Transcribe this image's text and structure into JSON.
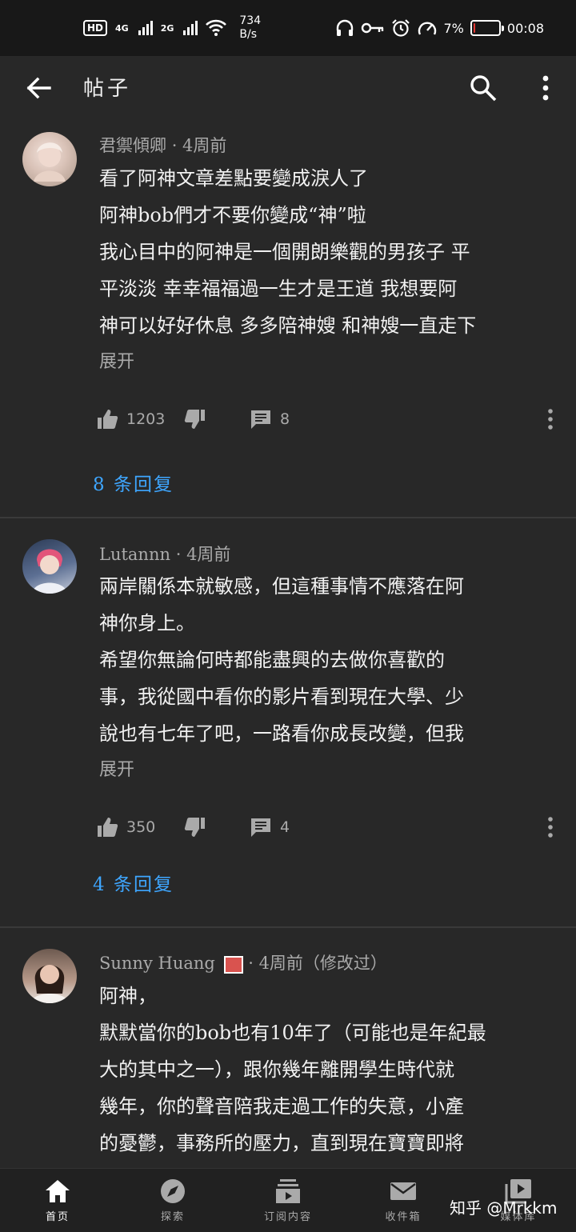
{
  "status_bar": {
    "hd": "HD",
    "sim1": "4G",
    "sim2": "2G",
    "speed_value": "734",
    "speed_unit": "B/s",
    "battery_percent": "7%",
    "battery_level": 0.07,
    "time": "00:08",
    "icons": [
      "hd-icon",
      "signal-icon",
      "wifi-icon",
      "headphone-icon",
      "key-icon",
      "alarm-icon",
      "speedometer-icon",
      "battery-icon"
    ]
  },
  "app_bar": {
    "title": "帖子",
    "icons": [
      "back-arrow-icon",
      "search-icon",
      "more-vert-icon"
    ]
  },
  "comments": [
    {
      "author": "君禦傾卿",
      "time": "4周前",
      "lines": [
        "看了阿神文章差點要變成淚人了",
        "阿神bob們才不要你變成“神”啦",
        "我心目中的阿神是一個開朗樂觀的男孩子 平",
        "平淡淡 幸幸福福過一生才是王道 我想要阿",
        "神可以好好休息 多多陪神嫂 和神嫂一直走下"
      ],
      "expand": "展开",
      "likes": "1203",
      "replies_count": "8",
      "replies_link": "8 条回复"
    },
    {
      "author": "Lutannn",
      "time": "4周前",
      "lines": [
        "兩岸關係本就敏感，但這種事情不應落在阿",
        "神你身上。",
        "希望你無論何時都能盡興的去做你喜歡的",
        "事，我從國中看你的影片看到現在大學、少",
        "說也有七年了吧，一路看你成長改變，但我"
      ],
      "expand": "展开",
      "likes": "350",
      "replies_count": "4",
      "replies_link": "4 条回复"
    },
    {
      "author": "Sunny Huang",
      "time": "4周前（修改过）",
      "lines": [
        "阿神，",
        "默默當你的bob也有10年了（可能也是年紀最",
        "大的其中之一），跟你幾年離開學生時代就",
        "幾年，你的聲音陪我走過工作的失意，小產",
        "的憂鬱，事務所的壓力，直到現在寶寶即將"
      ]
    }
  ],
  "bottom_nav": [
    {
      "label": "首页",
      "icon": "home-icon",
      "active": true
    },
    {
      "label": "探索",
      "icon": "compass-icon",
      "active": false
    },
    {
      "label": "订阅内容",
      "icon": "subscriptions-icon",
      "active": false
    },
    {
      "label": "收件箱",
      "icon": "mail-icon",
      "active": false
    },
    {
      "label": "媒体库",
      "icon": "library-icon",
      "active": false
    }
  ],
  "watermark": "知乎 @Mrkkm",
  "colors": {
    "background": "#282828",
    "status_bar": "#181818",
    "link": "#3ea6ff",
    "battery_low": "#e53935"
  }
}
